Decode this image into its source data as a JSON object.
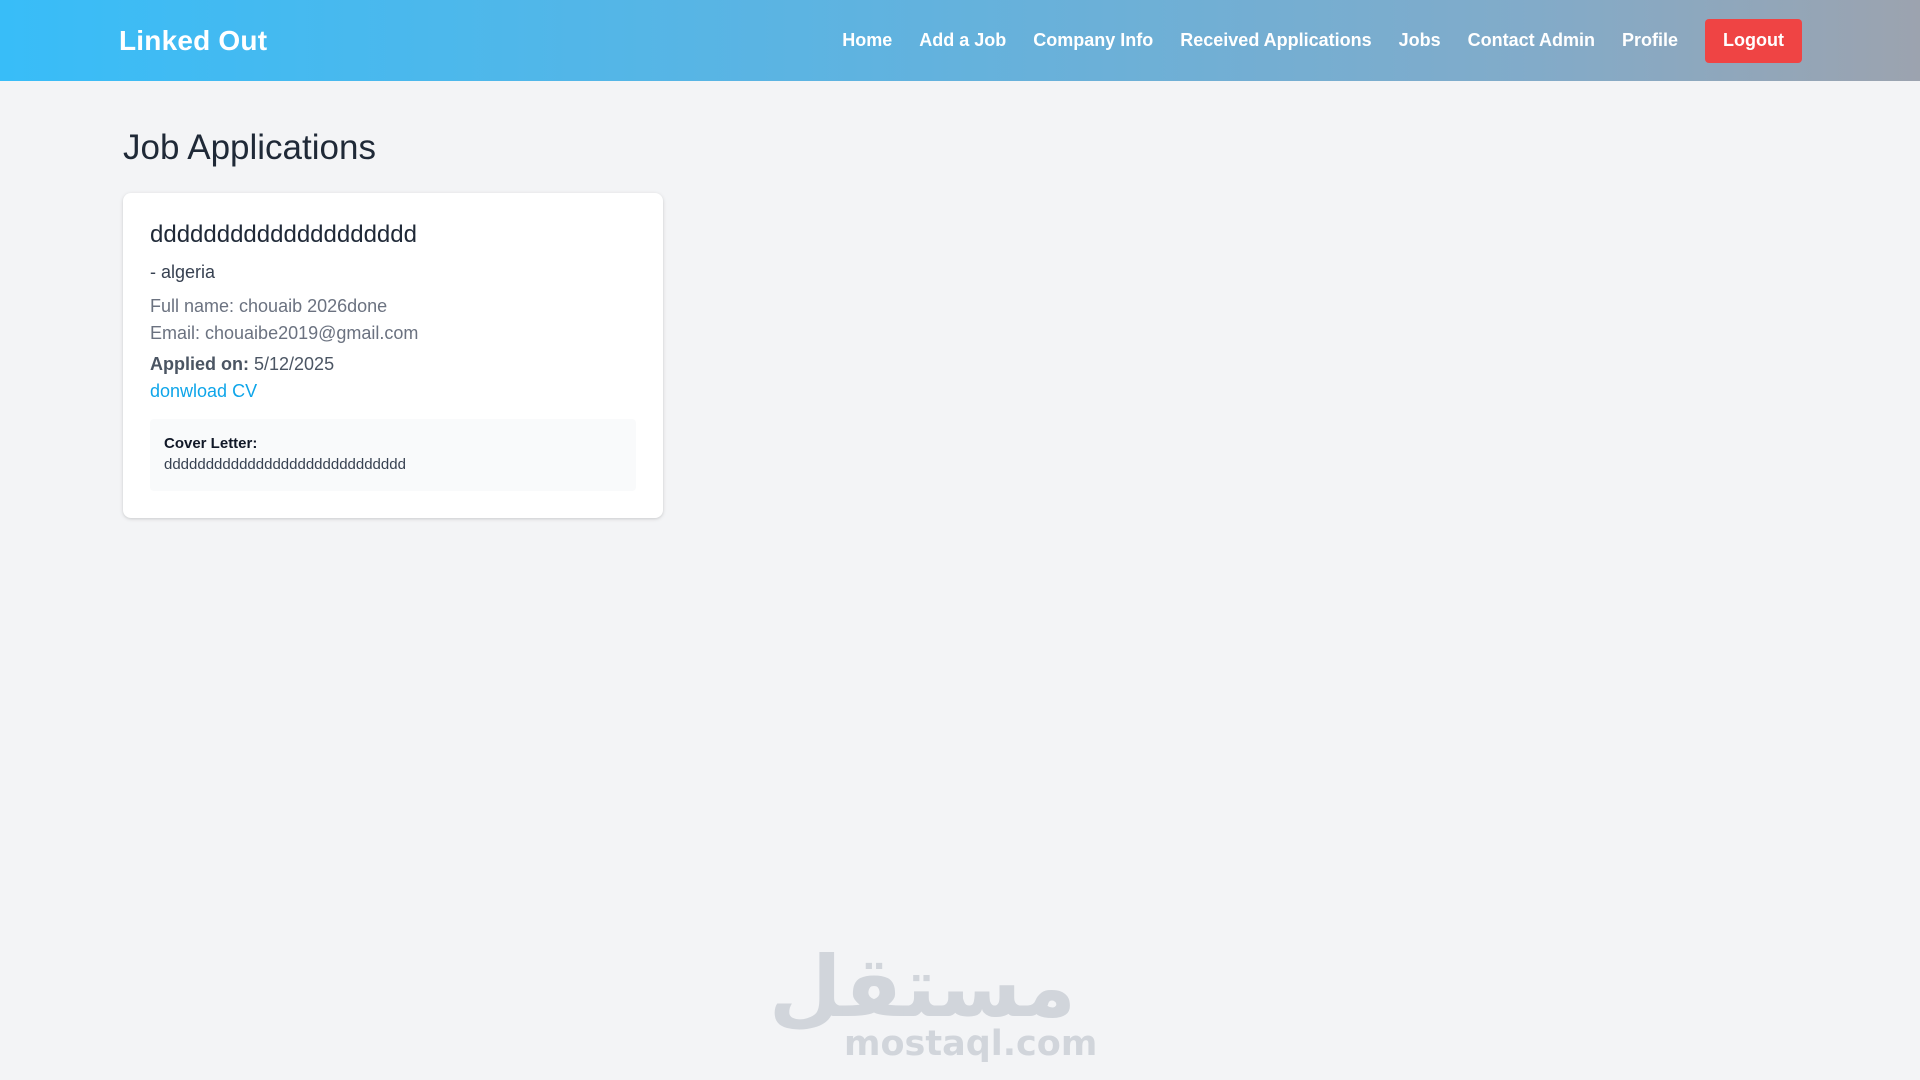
{
  "navbar": {
    "brand": "Linked Out",
    "links": [
      "Home",
      "Add a Job",
      "Company Info",
      "Received Applications",
      "Jobs",
      "Contact Admin",
      "Profile"
    ],
    "logout_label": "Logout",
    "colors": {
      "gradient_start": "#38bdf8",
      "gradient_end": "#9ca3af",
      "logout": "#ef4444"
    }
  },
  "page": {
    "title": "Job Applications"
  },
  "applications": [
    {
      "job_title": "dddddddddddddddddddd",
      "location": "- algeria",
      "full_name_line": "Full name: chouaib 2026done",
      "email_line": "Email: chouaibe2019@gmail.com",
      "applied_label": "Applied on:",
      "applied_date": "5/12/2025",
      "cv_link_label": "donwload CV",
      "cover_letter_label": "Cover Letter:",
      "cover_letter_text": "ddddddddddddddddddddddddddddd"
    }
  ],
  "watermark": {
    "arabic": "مستقل",
    "latin": "mostaql.com"
  }
}
